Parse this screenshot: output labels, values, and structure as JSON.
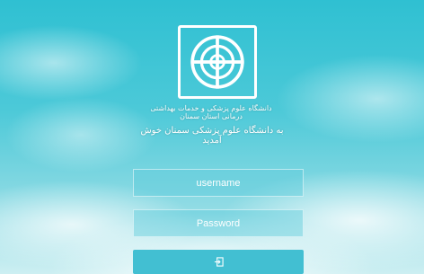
{
  "branding": {
    "university_name": "دانشگاه علوم پزشکی و خدمات بهداشتی درمانی استان سمنان",
    "logo_icon": "university-emblem-icon"
  },
  "welcome_text": "به دانشگاه علوم پزشکی سمنان خوش آمدید",
  "form": {
    "username_placeholder": "username",
    "password_placeholder": "Password",
    "submit_icon": "sign-in-icon"
  },
  "colors": {
    "accent": "#42bfd2",
    "sky": "#2fc0d2"
  }
}
